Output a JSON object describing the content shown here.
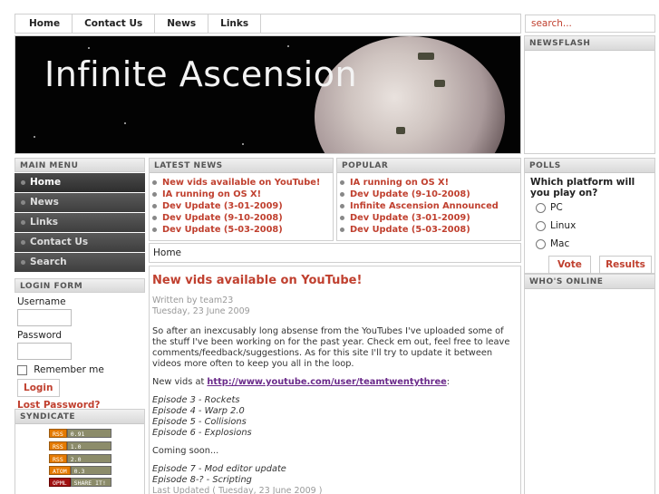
{
  "nav": {
    "items": [
      "Home",
      "Contact Us",
      "News",
      "Links"
    ]
  },
  "search": {
    "placeholder": "search..."
  },
  "banner": {
    "title": "Infinite Ascension"
  },
  "newsflash": {
    "title": "NEWSFLASH"
  },
  "main_menu": {
    "title": "MAIN MENU",
    "items": [
      "Home",
      "News",
      "Links",
      "Contact Us",
      "Search"
    ]
  },
  "login": {
    "title": "LOGIN FORM",
    "username_label": "Username",
    "password_label": "Password",
    "remember_label": "Remember me",
    "login_button": "Login",
    "lost_password": "Lost Password?"
  },
  "syndicate": {
    "title": "SYNDICATE",
    "feeds": [
      {
        "left": "RSS",
        "right": "0.91"
      },
      {
        "left": "RSS",
        "right": "1.0"
      },
      {
        "left": "RSS",
        "right": "2.0"
      },
      {
        "left": "ATOM",
        "right": "0.3"
      },
      {
        "left": "OPML",
        "right": "SHARE IT!"
      }
    ]
  },
  "latest_news": {
    "title": "LATEST NEWS",
    "items": [
      "New vids available on YouTube!",
      "IA running on OS X!",
      "Dev Update (3-01-2009)",
      "Dev Update (9-10-2008)",
      "Dev Update (5-03-2008)"
    ]
  },
  "popular": {
    "title": "POPULAR",
    "items": [
      "IA running on OS X!",
      "Dev Update (9-10-2008)",
      "Infinite Ascension Announced",
      "Dev Update (3-01-2009)",
      "Dev Update (5-03-2008)"
    ]
  },
  "breadcrumb": "Home",
  "article": {
    "title": "New vids available on YouTube!",
    "author": "Written by team23",
    "date": "Tuesday, 23 June 2009",
    "body": "So after an inexcusably long absense from the YouTubes I've uploaded some of the stuff I've been working on for the past year.  Check em out, feel free to leave comments/feedback/suggestions.  As for this site I'll try to update it between videos more often to keep you all in the loop.",
    "vids_prefix": "New vids at ",
    "vids_link": "http://www.youtube.com/user/teamtwentythree",
    "vids_suffix": ":",
    "episodes": [
      "Episode 3 - Rockets",
      "Episode 4 - Warp 2.0",
      "Episode 5 - Collisions",
      "Episode 6 - Explosions"
    ],
    "coming_soon": "Coming soon...",
    "upcoming": [
      "Episode 7 - Mod editor update",
      "Episode 8-? - Scripting"
    ],
    "last_updated": "Last Updated ( Tuesday, 23 June 2009 )"
  },
  "polls": {
    "title": "POLLS",
    "question": "Which platform will you play on?",
    "options": [
      "PC",
      "Linux",
      "Mac"
    ],
    "vote_button": "Vote",
    "results_button": "Results"
  },
  "whos_online": {
    "title": "WHO'S ONLINE"
  }
}
